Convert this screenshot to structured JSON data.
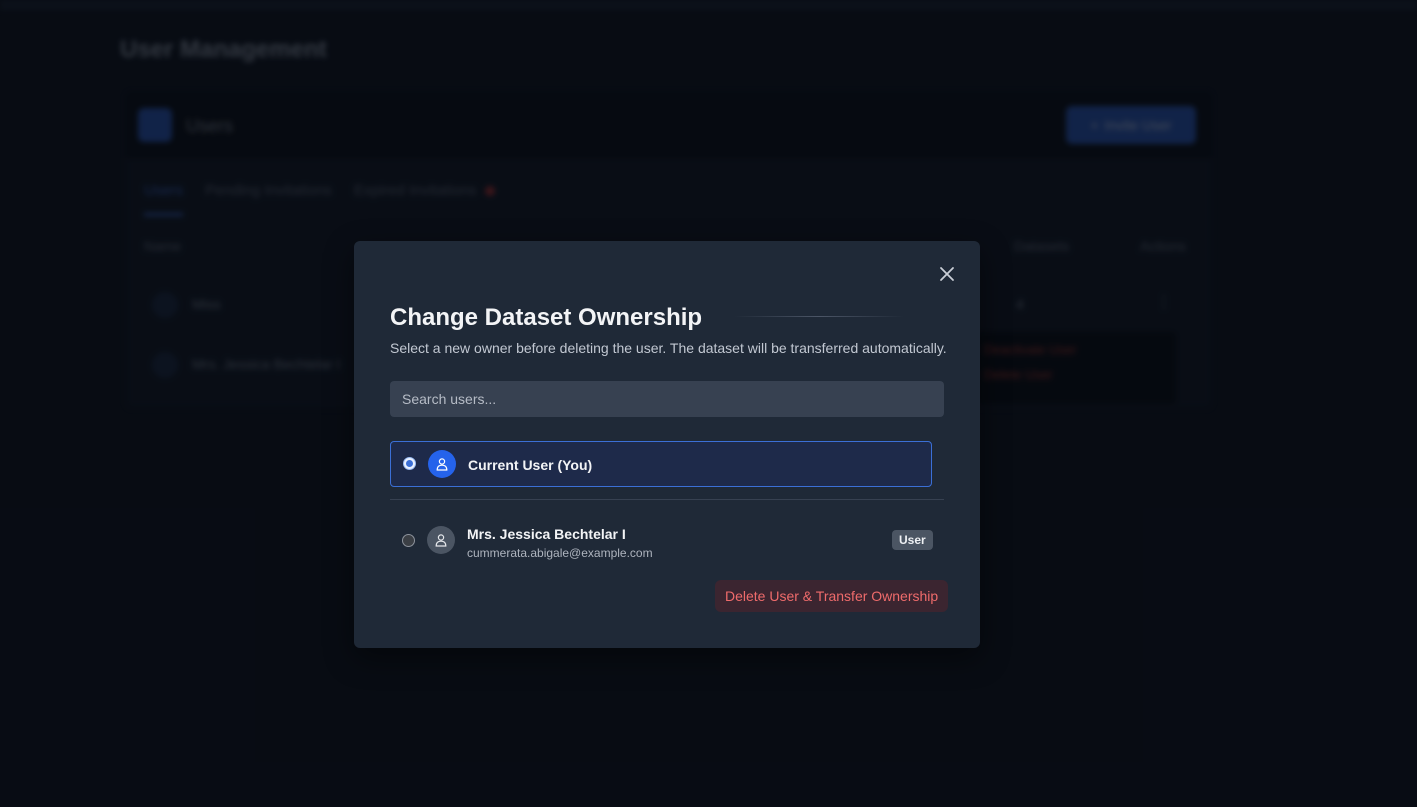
{
  "background": {
    "page_title": "User Management",
    "card_title": "Users",
    "invite_button": "Invite User",
    "tabs": [
      {
        "label": "Users",
        "active": true
      },
      {
        "label": "Pending Invitations",
        "active": false
      },
      {
        "label": "Expired Invitations",
        "active": false
      }
    ],
    "columns": [
      "Name",
      "Datasets",
      "Actions"
    ],
    "rows": [
      {
        "name": "Miss",
        "datasets": "4"
      },
      {
        "name": "Mrs. Jessica Bechtelar I",
        "datasets": ""
      }
    ],
    "row_menu": [
      "Deactivate User",
      "Delete User"
    ]
  },
  "modal": {
    "title": "Change Dataset Ownership",
    "description": "Select a new owner before deleting the user. The dataset will be transferred automatically.",
    "search_placeholder": "Search users...",
    "options": [
      {
        "name": "Current User (You)",
        "selected": true
      },
      {
        "name": "Mrs. Jessica Bechtelar I",
        "email": "cummerata.abigale@example.com",
        "role": "User",
        "selected": false
      }
    ],
    "delete_button": "Delete User & Transfer Ownership"
  },
  "colors": {
    "modal_bg": "#1f2937",
    "accent": "#2563eb",
    "danger": "#ef6b6b"
  }
}
